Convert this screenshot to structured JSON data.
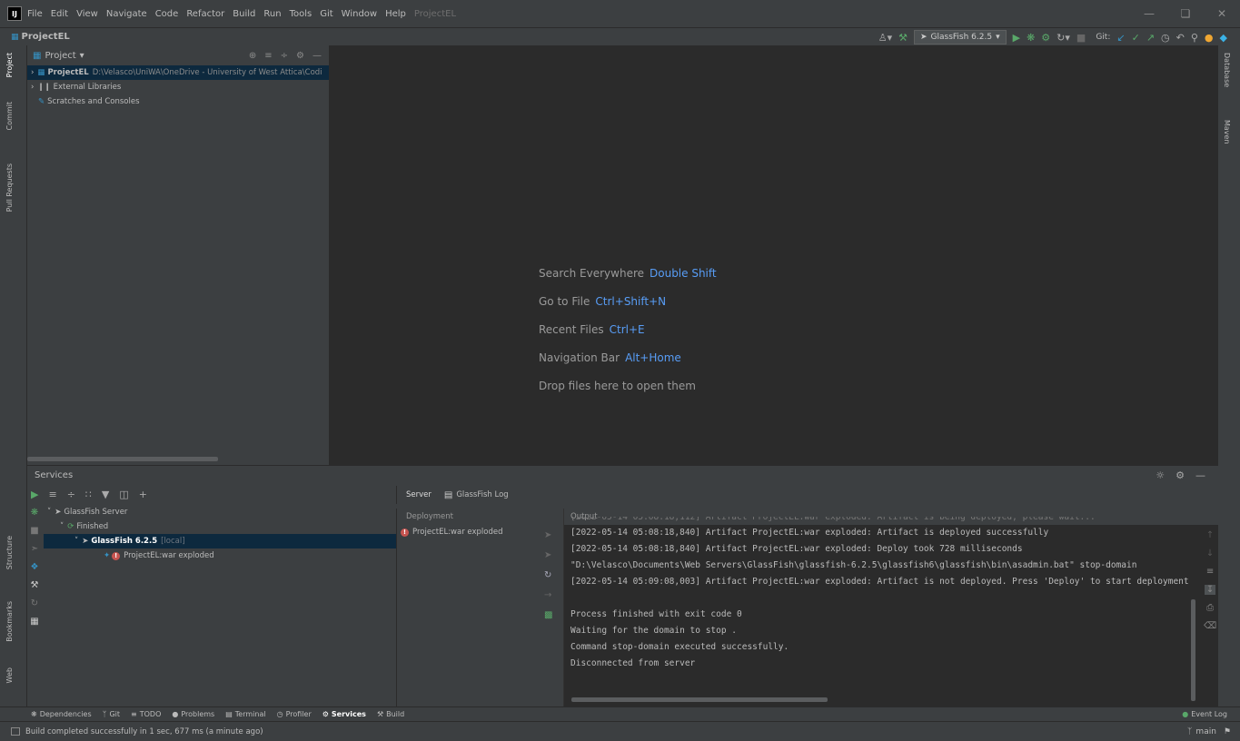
{
  "app": {
    "logo": "IJ",
    "title": "ProjectEL"
  },
  "menu": [
    "File",
    "Edit",
    "View",
    "Navigate",
    "Code",
    "Refactor",
    "Build",
    "Run",
    "Tools",
    "Git",
    "Window",
    "Help"
  ],
  "navbar": {
    "project": "ProjectEL",
    "run_config": "GlassFish 6.2.5",
    "git_label": "Git:"
  },
  "left_tabs": {
    "project": "Project",
    "commit": "Commit",
    "pull_requests": "Pull Requests",
    "structure": "Structure",
    "bookmarks": "Bookmarks",
    "web": "Web"
  },
  "right_tabs": {
    "database": "Database",
    "maven": "Maven"
  },
  "project_panel": {
    "title": "Project",
    "root": {
      "name": "ProjectEL",
      "path": "D:\\Velasco\\UniWA\\OneDrive - University of West Attica\\Codi"
    },
    "external": "External Libraries",
    "scratches": "Scratches and Consoles"
  },
  "editor_hints": [
    {
      "label": "Search Everywhere",
      "key": "Double Shift"
    },
    {
      "label": "Go to File",
      "key": "Ctrl+Shift+N"
    },
    {
      "label": "Recent Files",
      "key": "Ctrl+E"
    },
    {
      "label": "Navigation Bar",
      "key": "Alt+Home"
    },
    {
      "label": "Drop files here to open them",
      "key": ""
    }
  ],
  "services": {
    "title": "Services",
    "tree": {
      "server_group": "GlassFish Server",
      "finished": "Finished",
      "server": "GlassFish 6.2.5",
      "server_tag": "[local]",
      "artifact": "ProjectEL:war exploded"
    },
    "tabs": {
      "server": "Server",
      "log": "GlassFish Log"
    },
    "deployment_header": "Deployment",
    "deployment_item": "ProjectEL:war exploded",
    "output_header": "Output",
    "output_lines": [
      "[2022-05-14 05:08:18,112] Artifact ProjectEL:war exploded: Artifact is being deployed, please wait...",
      "[2022-05-14 05:08:18,840] Artifact ProjectEL:war exploded: Artifact is deployed successfully",
      "[2022-05-14 05:08:18,840] Artifact ProjectEL:war exploded: Deploy took 728 milliseconds",
      "\"D:\\Velasco\\Documents\\Web Servers\\GlassFish\\glassfish-6.2.5\\glassfish6\\glassfish\\bin\\asadmin.bat\" stop-domain",
      "[2022-05-14 05:09:08,003] Artifact ProjectEL:war exploded: Artifact is not deployed. Press 'Deploy' to start deployment",
      "",
      "Process finished with exit code 0",
      "Waiting for the domain to stop .",
      "Command stop-domain executed successfully.",
      "Disconnected from server"
    ]
  },
  "bottom_tabs": [
    "Dependencies",
    "Git",
    "TODO",
    "Problems",
    "Terminal",
    "Profiler",
    "Services",
    "Build"
  ],
  "event_log": "Event Log",
  "status": {
    "message": "Build completed successfully in 1 sec, 677 ms (a minute ago)",
    "branch": "main"
  }
}
